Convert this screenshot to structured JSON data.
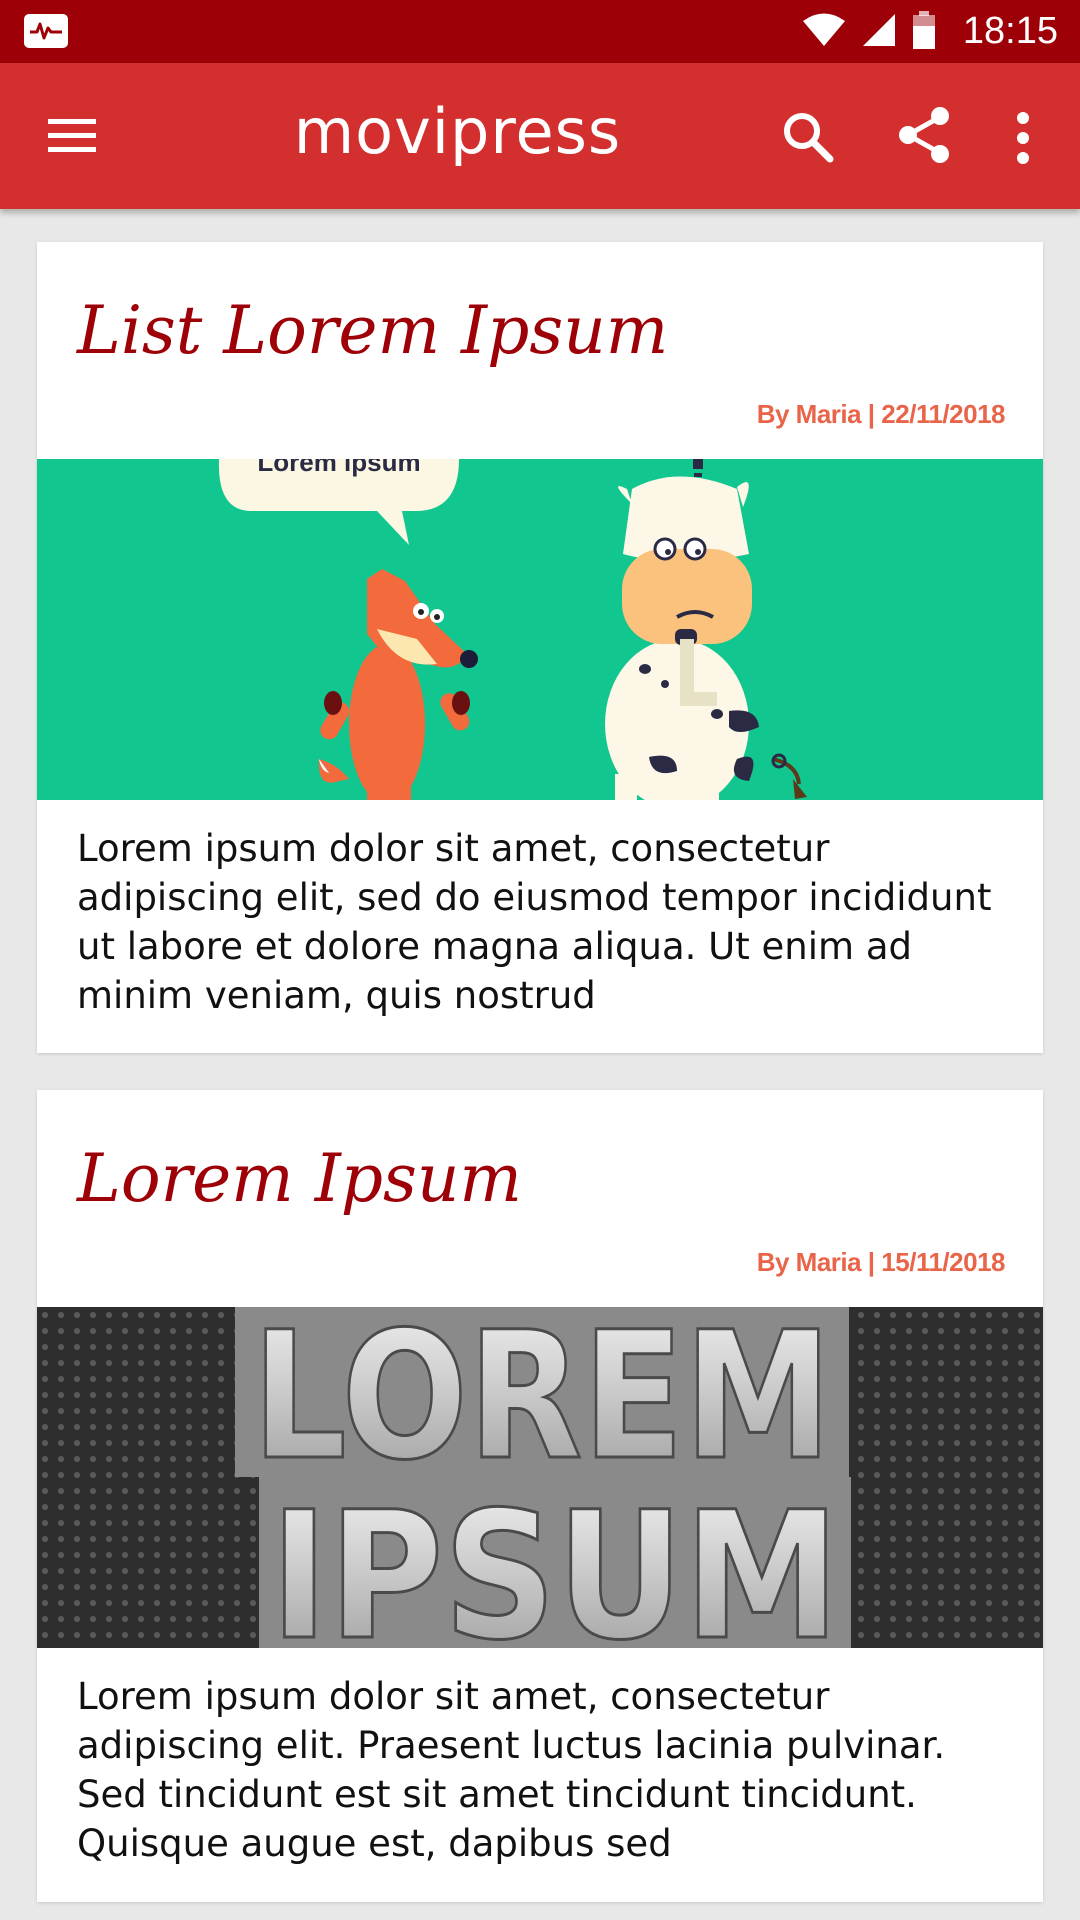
{
  "status_bar": {
    "time": "18:15",
    "icons": [
      "pulse-app-icon",
      "wifi-icon",
      "signal-icon",
      "battery-icon"
    ]
  },
  "app_bar": {
    "title": "movipress",
    "icons": [
      "menu-icon",
      "search-icon",
      "share-icon",
      "more-vert-icon"
    ]
  },
  "colors": {
    "status_bar": "#9e0008",
    "app_bar": "#d32f2f",
    "title_text": "#9e0008",
    "meta_text": "#e8654a",
    "background": "#e8e8e8"
  },
  "posts": [
    {
      "title": "List Lorem Ipsum",
      "meta": "By Maria | 22/11/2018",
      "image_caption": "Lorem ipsum",
      "excerpt": "Lorem ipsum dolor sit amet, consectetur adipiscing elit, sed do eiusmod tempor incididunt ut labore et dolore magna aliqua. Ut enim ad minim veniam, quis nostrud"
    },
    {
      "title": "Lorem Ipsum",
      "meta": "By Maria | 15/11/2018",
      "image_words": [
        "LOREM",
        "IPSUM"
      ],
      "excerpt": "Lorem ipsum dolor sit amet, consectetur adipiscing elit. Praesent luctus lacinia pulvinar. Sed tincidunt est sit amet tincidunt tincidunt. Quisque augue est, dapibus sed"
    }
  ]
}
